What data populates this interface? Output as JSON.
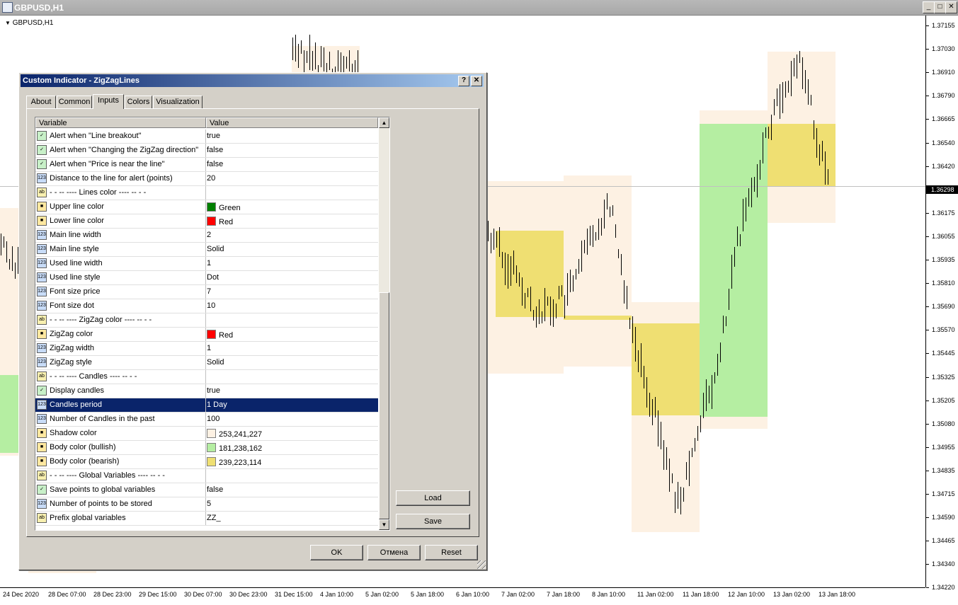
{
  "window": {
    "title": "GBPUSD,H1"
  },
  "chart": {
    "symbol_label": "GBPUSD,H1",
    "current_price": "1.36298",
    "price_labels": [
      "1.37155",
      "1.37030",
      "1.36910",
      "1.36790",
      "1.36665",
      "1.36540",
      "1.36420",
      "1.36298",
      "1.36175",
      "1.36055",
      "1.35935",
      "1.35810",
      "1.35690",
      "1.35570",
      "1.35445",
      "1.35325",
      "1.35205",
      "1.35080",
      "1.34955",
      "1.34835",
      "1.34715",
      "1.34590",
      "1.34465",
      "1.34340",
      "1.34220"
    ],
    "time_labels": [
      "24 Dec 2020",
      "28 Dec 07:00",
      "28 Dec 23:00",
      "29 Dec 15:00",
      "30 Dec 07:00",
      "30 Dec 23:00",
      "31 Dec 15:00",
      "4 Jan 10:00",
      "5 Jan 02:00",
      "5 Jan 18:00",
      "6 Jan 10:00",
      "7 Jan 02:00",
      "7 Jan 18:00",
      "8 Jan 10:00",
      "11 Jan 02:00",
      "11 Jan 18:00",
      "12 Jan 10:00",
      "13 Jan 02:00",
      "13 Jan 18:00"
    ],
    "colors": {
      "shadow": "#fdf1e3",
      "bullish": "#b5eea2",
      "bearish": "#efdf72"
    }
  },
  "dialog": {
    "title": "Custom Indicator - ZigZagLines",
    "help_btn": "?",
    "close_btn": "✕",
    "tabs": [
      "About",
      "Common",
      "Inputs",
      "Colors",
      "Visualization"
    ],
    "active_tab": "Inputs",
    "col_variable": "Variable",
    "col_value": "Value",
    "rows": [
      {
        "icon": "bool",
        "name": "Alert when \"Line breakout\"",
        "value": "true"
      },
      {
        "icon": "bool",
        "name": "Alert when \"Changing the ZigZag direction\"",
        "value": "false"
      },
      {
        "icon": "bool",
        "name": "Alert when \"Price is near the line\"",
        "value": "false"
      },
      {
        "icon": "int",
        "name": "Distance to the line for alert (points)",
        "value": "20"
      },
      {
        "icon": "str",
        "name": "-    -    -- ---- Lines color ---- --    -    -",
        "value": ""
      },
      {
        "icon": "color",
        "name": "Upper line color",
        "value": "Green",
        "swatch": "#008000"
      },
      {
        "icon": "color",
        "name": "Lower line color",
        "value": "Red",
        "swatch": "#ff0000"
      },
      {
        "icon": "int",
        "name": "Main line width",
        "value": "2"
      },
      {
        "icon": "int",
        "name": "Main line style",
        "value": "Solid"
      },
      {
        "icon": "int",
        "name": "Used line width",
        "value": "1"
      },
      {
        "icon": "int",
        "name": "Used line style",
        "value": "Dot"
      },
      {
        "icon": "int",
        "name": "Font size price",
        "value": "7"
      },
      {
        "icon": "int",
        "name": "Font size dot",
        "value": "10"
      },
      {
        "icon": "str",
        "name": "-    -    -- ---- ZigZag color ---- --    -    -",
        "value": ""
      },
      {
        "icon": "color",
        "name": "ZigZag color",
        "value": "Red",
        "swatch": "#ff0000"
      },
      {
        "icon": "int",
        "name": "ZigZag width",
        "value": "1"
      },
      {
        "icon": "int",
        "name": "ZigZag style",
        "value": "Solid"
      },
      {
        "icon": "str",
        "name": "-    -    -- ---- Candles ---- --    -    -",
        "value": ""
      },
      {
        "icon": "bool",
        "name": "Display candles",
        "value": "true"
      },
      {
        "icon": "int",
        "name": "Candles period",
        "value": "1 Day",
        "selected": true
      },
      {
        "icon": "int",
        "name": "Number of Candles in the past",
        "value": "100"
      },
      {
        "icon": "color",
        "name": "Shadow color",
        "value": "253,241,227",
        "swatch": "#fdf1e3"
      },
      {
        "icon": "color",
        "name": "Body color (bullish)",
        "value": "181,238,162",
        "swatch": "#b5eea2"
      },
      {
        "icon": "color",
        "name": "Body color (bearish)",
        "value": "239,223,114",
        "swatch": "#efdf72"
      },
      {
        "icon": "str",
        "name": "-    -    -- ---- Global Variables ---- --    -    -",
        "value": ""
      },
      {
        "icon": "bool",
        "name": "Save points to global variables",
        "value": "false"
      },
      {
        "icon": "int",
        "name": "Number of points to be stored",
        "value": "5"
      },
      {
        "icon": "str",
        "name": "Prefix global variables",
        "value": "ZZ_"
      }
    ],
    "load_btn": "Load",
    "save_btn": "Save",
    "ok_btn": "OK",
    "cancel_btn": "Отмена",
    "reset_btn": "Reset"
  }
}
